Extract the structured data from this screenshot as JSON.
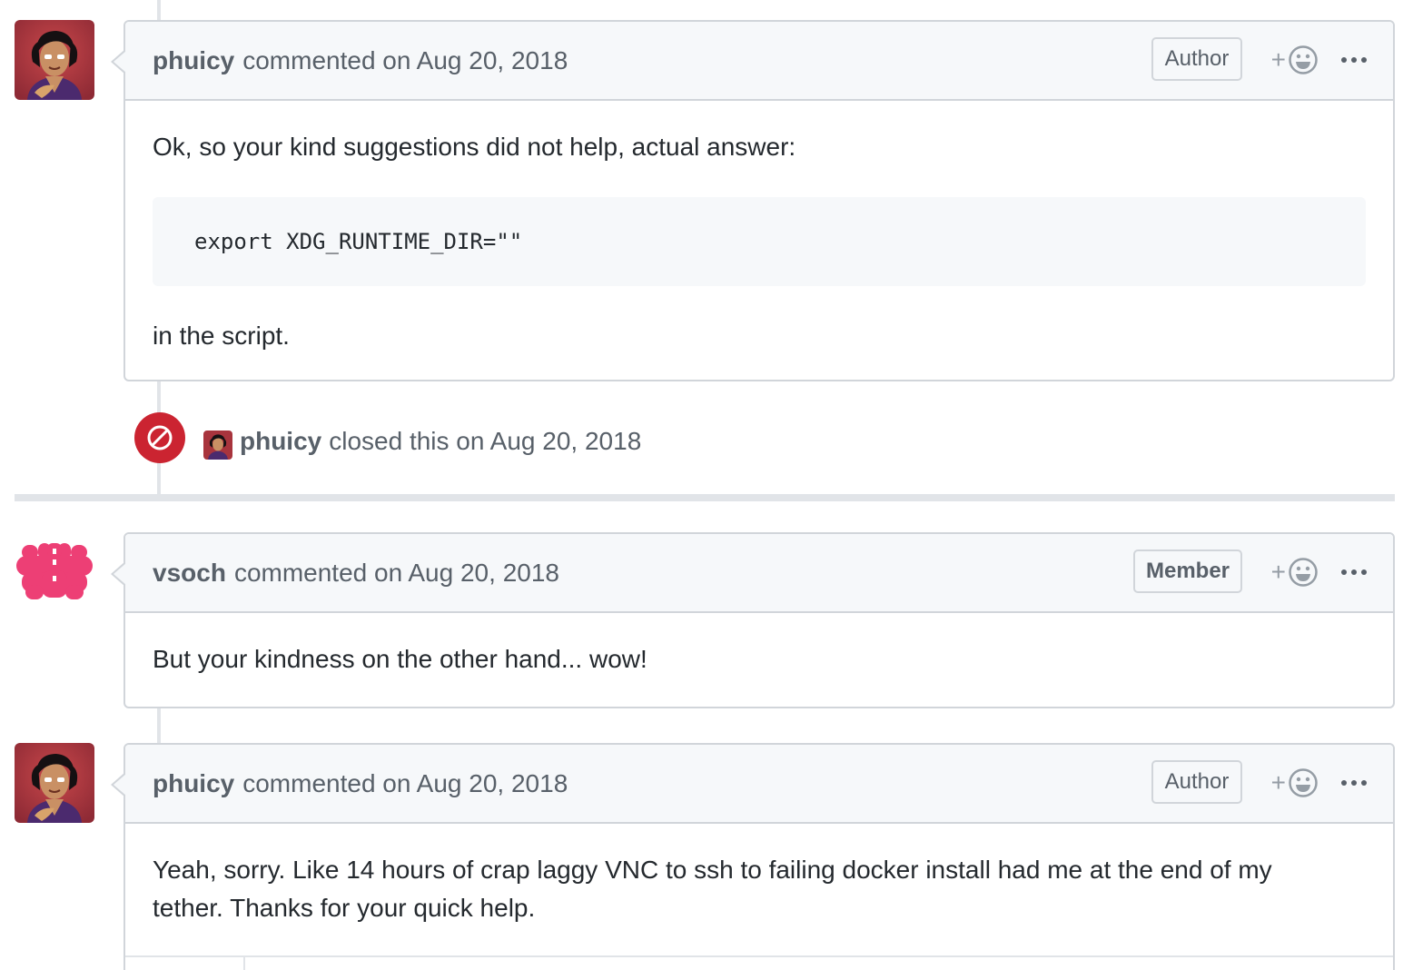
{
  "comments": [
    {
      "author": "phuicy",
      "meta": "commented on Aug 20, 2018",
      "role": "Author",
      "body_intro": "Ok, so your kind suggestions did not help, actual answer:",
      "code": "export XDG_RUNTIME_DIR=\"\"",
      "body_outro": "in the script."
    },
    {
      "author": "vsoch",
      "meta": "commented on Aug 20, 2018",
      "role": "Member",
      "body": "But your kindness on the other hand... wow!"
    },
    {
      "author": "phuicy",
      "meta": "commented on Aug 20, 2018",
      "role": "Author",
      "body": "Yeah, sorry. Like 14 hours of crap laggy VNC to ssh to failing docker install had me at the end of my tether. Thanks for your quick help."
    }
  ],
  "closed_event": {
    "author": "phuicy",
    "text": "closed this on Aug 20, 2018"
  },
  "reaction": {
    "plus": "+"
  },
  "colors": {
    "closed": "#cb2431",
    "identicon": "#ed3f75",
    "border": "#d1d5da",
    "header_bg": "#f6f8fa"
  },
  "icons": {
    "closed_event": "circle-slash-icon",
    "reaction": "smiley-icon",
    "more": "kebab-horizontal-icon"
  }
}
